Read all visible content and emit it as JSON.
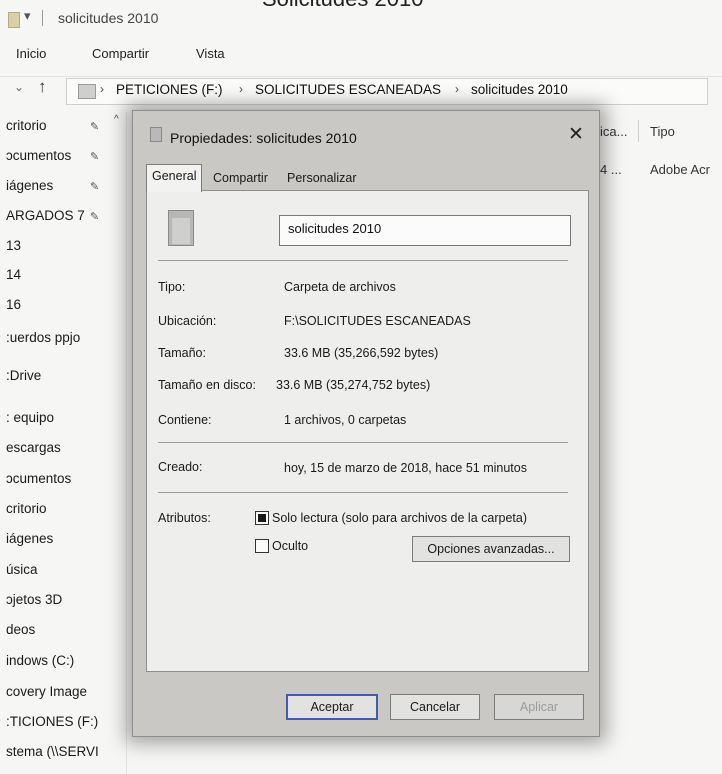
{
  "page_caption": "Solicitudes 2010",
  "window": {
    "title": "solicitudes 2010",
    "ribbon_tabs": [
      "Inicio",
      "Compartir",
      "Vista"
    ]
  },
  "address_bar": {
    "crumbs": [
      "PETICIONES (F:)",
      "SOLICITUDES ESCANEADAS",
      "solicitudes 2010"
    ]
  },
  "nav_pane": {
    "items": [
      {
        "label": "critorio",
        "pinned": true
      },
      {
        "label": "ɔcumentos",
        "pinned": true
      },
      {
        "label": "iágenes",
        "pinned": true
      },
      {
        "label": "ARGADOS 7",
        "pinned": true
      },
      {
        "label": "13",
        "pinned": false
      },
      {
        "label": "14",
        "pinned": false
      },
      {
        "label": "16",
        "pinned": false
      },
      {
        "label": ":uerdos ppjo",
        "pinned": false
      },
      {
        "label": ":Drive",
        "pinned": false
      },
      {
        "label": ": equipo",
        "pinned": false
      },
      {
        "label": "escargas",
        "pinned": false
      },
      {
        "label": "ɔcumentos",
        "pinned": false
      },
      {
        "label": "critorio",
        "pinned": false
      },
      {
        "label": "iágenes",
        "pinned": false
      },
      {
        "label": "úsica",
        "pinned": false
      },
      {
        "label": "ɔjetos 3D",
        "pinned": false
      },
      {
        "label": "deos",
        "pinned": false
      },
      {
        "label": "indows (C:)",
        "pinned": false
      },
      {
        "label": "covery Image",
        "pinned": false
      },
      {
        "label": ":TICIONES (F:)",
        "pinned": false
      },
      {
        "label": "stema (\\\\SERVI",
        "pinned": false
      }
    ]
  },
  "file_list": {
    "columns": [
      "ica...",
      "Tipo"
    ],
    "row": {
      "col1": "4 ...",
      "tipo": "Adobe Acr"
    }
  },
  "dialog": {
    "title": "Propiedades: solicitudes 2010",
    "tabs": [
      "General",
      "Compartir",
      "Personalizar"
    ],
    "active_tab": "General",
    "name_value": "solicitudes 2010",
    "fields": [
      {
        "label": "Tipo:",
        "value": "Carpeta de archivos"
      },
      {
        "label": "Ubicación:",
        "value": "F:\\SOLICITUDES ESCANEADAS"
      },
      {
        "label": "Tamaño:",
        "value": "33.6 MB (35,266,592 bytes)"
      },
      {
        "label": "Tamaño en disco:",
        "value": "33.6 MB (35,274,752 bytes)"
      },
      {
        "label": "Contiene:",
        "value": "1 archivos, 0 carpetas"
      }
    ],
    "created": {
      "label": "Creado:",
      "value": "hoy, 15 de marzo de 2018, hace 51 minutos"
    },
    "attributes": {
      "label": "Atributos:",
      "readonly_label": "Solo lectura (solo para archivos de la carpeta)",
      "readonly_checked": true,
      "hidden_label": "Oculto",
      "hidden_checked": false,
      "advanced_button": "Opciones avanzadas..."
    },
    "buttons": {
      "ok": "Aceptar",
      "cancel": "Cancelar",
      "apply": "Aplicar"
    }
  }
}
